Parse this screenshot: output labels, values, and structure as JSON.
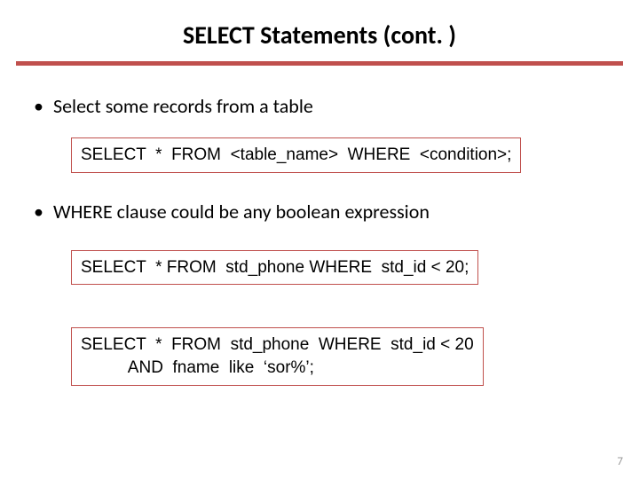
{
  "title": "SELECT Statements (cont. )",
  "bullets": {
    "b1": "Select some records from a table",
    "b2": "WHERE clause could be any boolean expression"
  },
  "code": {
    "c1": "SELECT  *  FROM  <table_name>  WHERE  <condition>;",
    "c2": "SELECT  * FROM  std_phone WHERE  std_id < 20;",
    "c3": "SELECT  *  FROM  std_phone  WHERE  std_id < 20\n          AND  fname  like  ‘sor%’;"
  },
  "page_number": "7"
}
